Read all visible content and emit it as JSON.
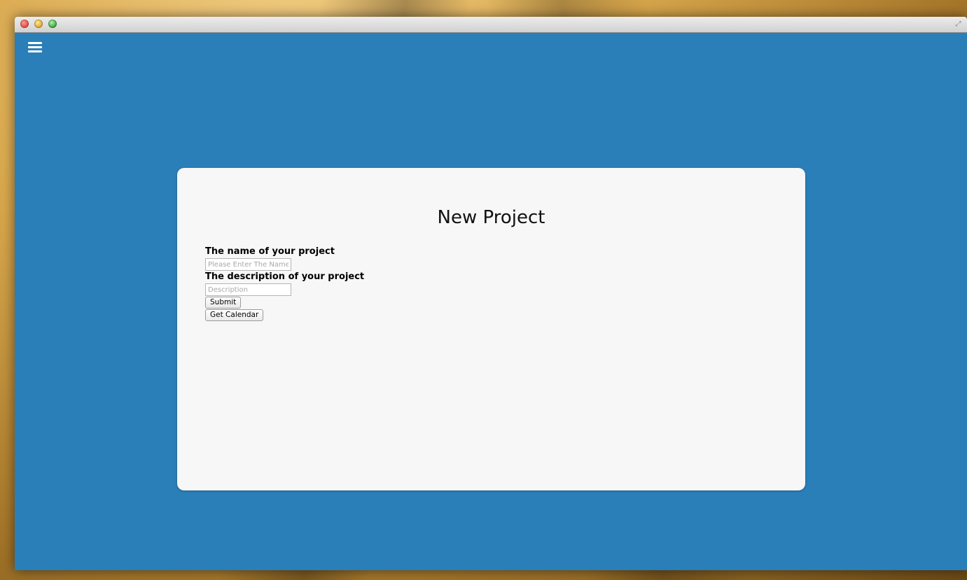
{
  "window": {
    "controls": {
      "close_icon": "close-traffic-light-icon",
      "minimize_icon": "minimize-traffic-light-icon",
      "zoom_icon": "zoom-traffic-light-icon",
      "fullscreen_icon": "fullscreen-icon",
      "fullscreen_glyph": "⤢"
    },
    "background_color": "#2a7fb9"
  },
  "menu": {
    "icon": "hamburger-menu-icon"
  },
  "card": {
    "title": "New Project",
    "form": {
      "name_label": "The name of your project",
      "name_placeholder": "Please Enter The Name",
      "name_value": "",
      "description_label": "The description of your project",
      "description_placeholder": "Description",
      "description_value": "",
      "submit_label": "Submit",
      "calendar_label": "Get Calendar"
    }
  }
}
